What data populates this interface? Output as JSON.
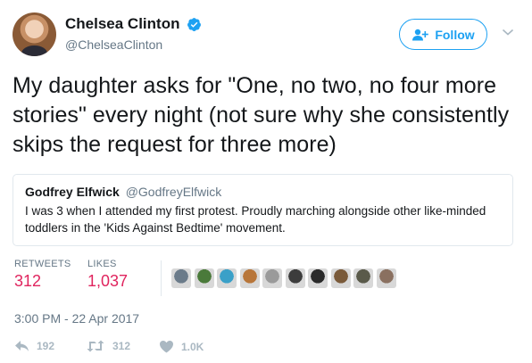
{
  "author": {
    "display_name": "Chelsea Clinton",
    "handle": "@ChelseaClinton",
    "verified": true,
    "avatar_icon": "profile-photo"
  },
  "follow_button": {
    "label": "Follow",
    "icon": "add-user-icon",
    "color": "#1da1f2"
  },
  "menu": {
    "icon": "chevron-down-icon"
  },
  "tweet": {
    "text": "My daughter asks for \"One, no two, no four more stories\" every night (not sure why she consistently skips the request for three more)"
  },
  "quoted_tweet": {
    "display_name": "Godfrey Elfwick",
    "handle": "@GodfreyElfwick",
    "text": "I was 3 when I attended my first protest. Proudly marching alongside other like-minded toddlers in the 'Kids Against Bedtime' movement."
  },
  "stats": {
    "retweets_label": "RETWEETS",
    "retweets_value": "312",
    "likes_label": "LIKES",
    "likes_value": "1,037",
    "value_color": "#e0245e"
  },
  "likers": [
    "#6b7b8a",
    "#4a7a3a",
    "#3aa0c8",
    "#b8763a",
    "#9a9a9a",
    "#3c3c3c",
    "#2a2a2a",
    "#7a5a3a",
    "#5a5a4a",
    "#8a7060"
  ],
  "timestamp": "3:00 PM - 22 Apr 2017",
  "actions": {
    "reply_count": "192",
    "retweet_count": "312",
    "like_count": "1.0K",
    "icon_color": "#aab8c2"
  }
}
